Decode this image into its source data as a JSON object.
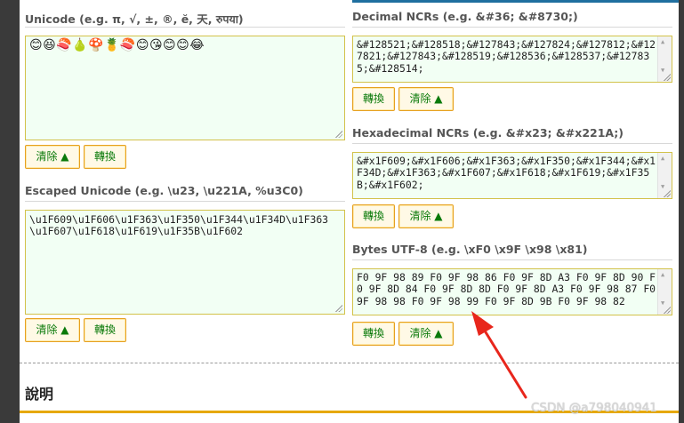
{
  "unicode": {
    "label": "Unicode (e.g. π, √, ±, ®, ĕ, 天, रुपया)",
    "value": "😊😆🍣🍐🍄🍍🍣😊😘😊😊😂",
    "clear_label": "清除 ▲",
    "convert_label": "轉換"
  },
  "escaped": {
    "label": "Escaped Unicode (e.g. \\u23, \\u221A, %u3C0)",
    "value": "\\u1F609\\u1F606\\u1F363\\u1F350\\u1F344\\u1F34D\\u1F363\\u1F607\\u1F618\\u1F619\\u1F35B\\u1F602",
    "clear_label": "清除 ▲",
    "convert_label": "轉換"
  },
  "decimal": {
    "label": "Decimal NCRs (e.g. &#36; &#8730;)",
    "value": "&#128521;&#128518;&#127843;&#127824;&#127812;&#127821;&#127843;&#128519;&#128536;&#128537;&#127835;&#128514;",
    "convert_label": "轉換",
    "clear_label": "清除 ▲"
  },
  "hex": {
    "label": "Hexadecimal NCRs (e.g. &#x23; &#x221A;)",
    "value": "&#x1F609;&#x1F606;&#x1F363;&#x1F350;&#x1F344;&#x1F34D;&#x1F363;&#x1F607;&#x1F618;&#x1F619;&#x1F35B;&#x1F602;",
    "convert_label": "轉換",
    "clear_label": "清除 ▲"
  },
  "utf8": {
    "label": "Bytes UTF-8 (e.g. \\xF0 \\x9F \\x98 \\x81)",
    "value": "F0 9F 98 89 F0 9F 98 86 F0 9F 8D A3 F0 9F 8D 90 F0 9F 8D 84 F0 9F 8D 8D F0 9F 8D A3 F0 9F 98 87 F0 9F 98 98 F0 9F 98 99 F0 9F 8D 9B F0 9F 98 82",
    "convert_label": "轉換",
    "clear_label": "清除 ▲"
  },
  "explain_title": "說明",
  "watermark": "CSDN @a798040941",
  "colors": {
    "annotation_arrow": "#e8261c",
    "accent_gold": "#e6a800",
    "top_bar": "#1f6f9f"
  }
}
